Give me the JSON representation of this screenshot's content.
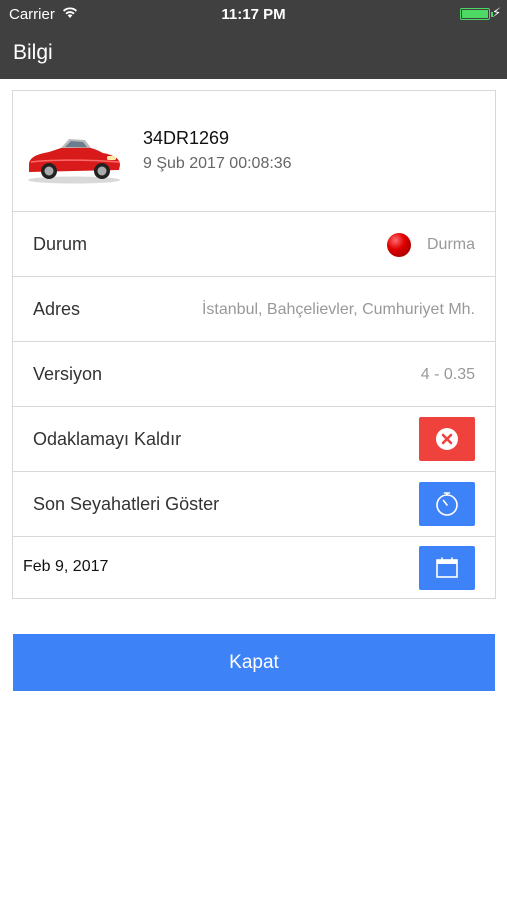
{
  "status_bar": {
    "carrier": "Carrier",
    "time": "11:17 PM",
    "battery_level": 1.0
  },
  "header": {
    "title": "Bilgi"
  },
  "vehicle": {
    "plate": "34DR1269",
    "datetime": "9 Şub 2017 00:08:36",
    "icon": "red-car-image"
  },
  "rows": {
    "status": {
      "label": "Durum",
      "value": "Durma",
      "indicator_color": "#d40000"
    },
    "address": {
      "label": "Adres",
      "value": "İstanbul, Bahçelievler, Cumhuriyet Mh."
    },
    "version": {
      "label": "Versiyon",
      "value": "4 - 0.35"
    },
    "unfocus": {
      "label": "Odaklamayı Kaldır",
      "icon": "close-circle-icon"
    },
    "trips": {
      "label": "Son Seyahatleri Göster",
      "icon": "timer-icon"
    }
  },
  "date_picker": {
    "value": "Feb 9, 2017",
    "icon": "calendar-icon"
  },
  "footer": {
    "close_label": "Kapat"
  },
  "colors": {
    "header_bg": "#404040",
    "accent_blue": "#3e82f7",
    "danger_red": "#f0423c"
  }
}
